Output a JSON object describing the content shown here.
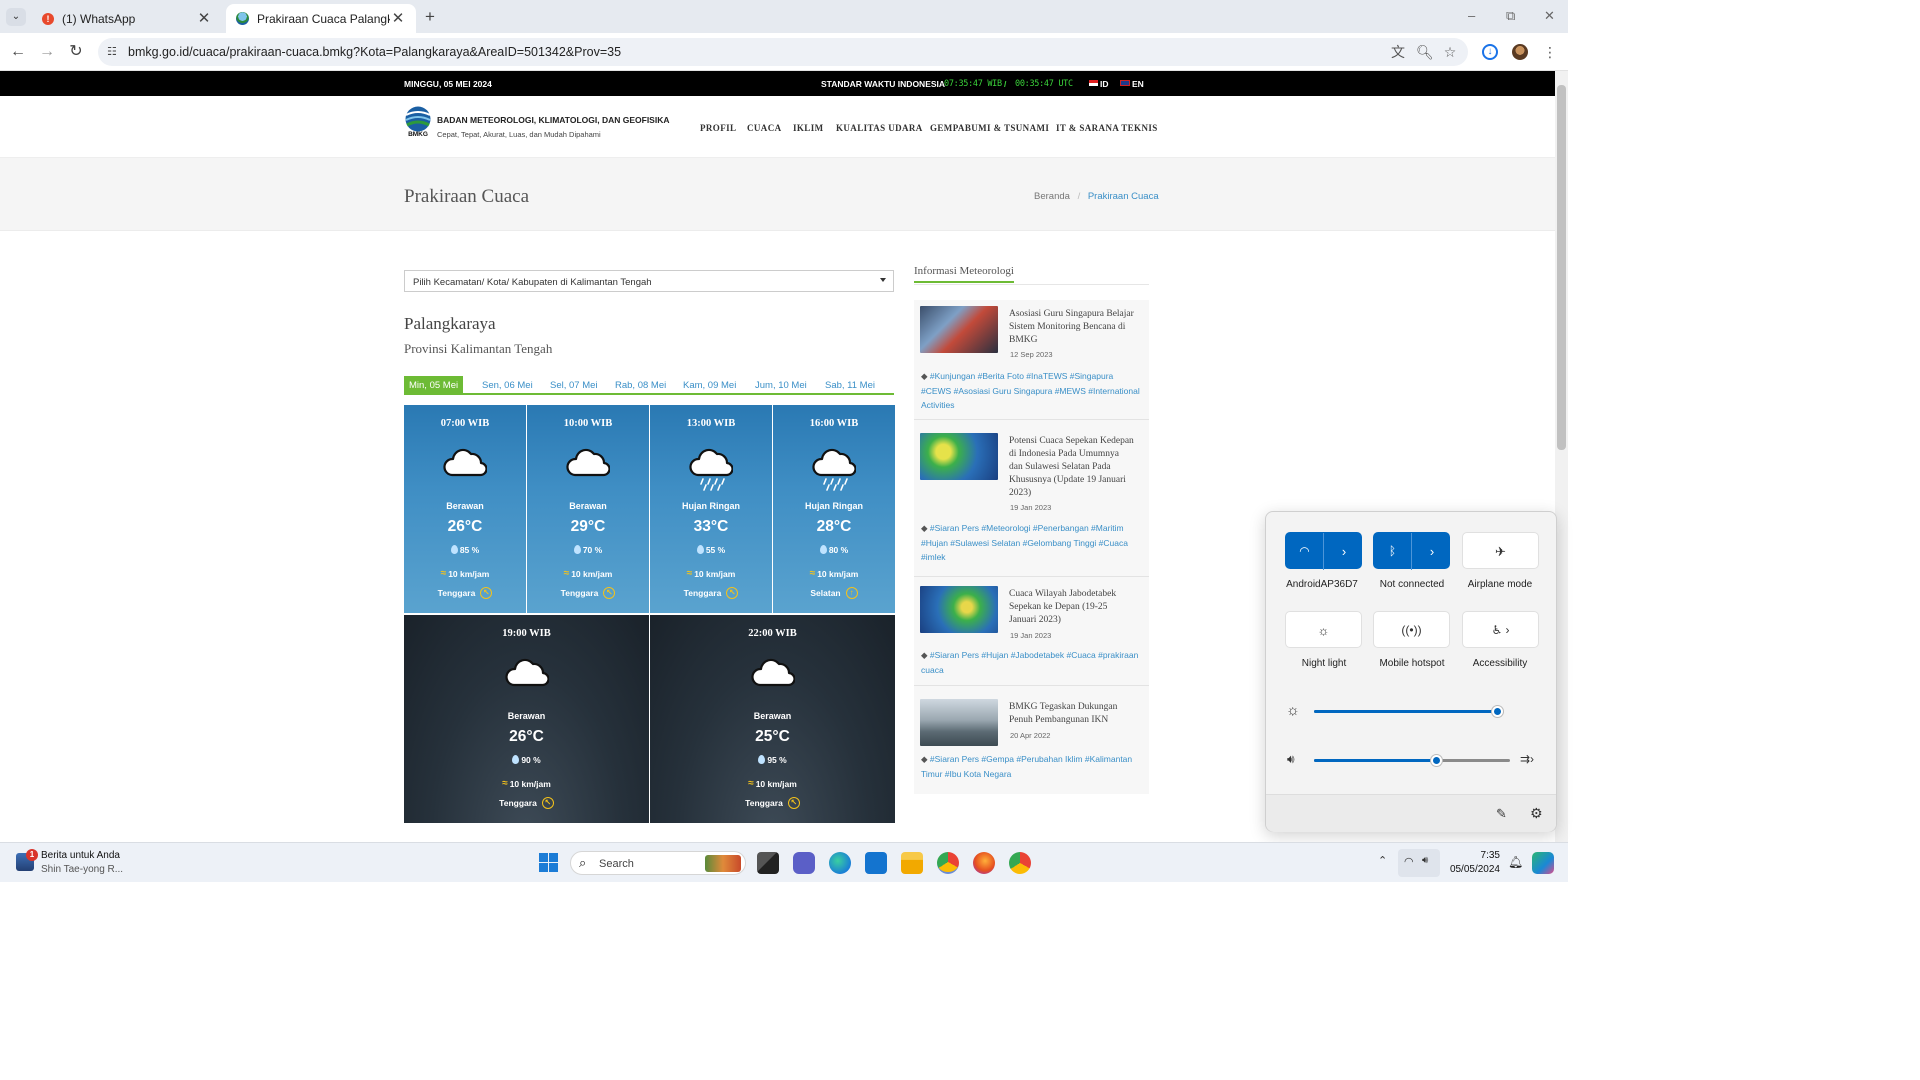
{
  "browser": {
    "tabs": [
      {
        "label": "(1) WhatsApp"
      },
      {
        "label": "Prakiraan Cuaca Palangkaraya -"
      }
    ],
    "url": "bmkg.go.id/cuaca/prakiraan-cuaca.bmkg?Kota=Palangkaraya&AreaID=501342&Prov=35"
  },
  "topbar": {
    "date": "MINGGU, 05 MEI 2024",
    "std_label": "STANDAR WAKTU INDONESIA",
    "wib": "07:35:47 WIB",
    "utc": "00:35:47 UTC",
    "lang_id": "ID",
    "lang_en": "EN",
    "clock_color": "#3ad23a"
  },
  "header": {
    "logo_text": "BMKG",
    "org": "BADAN METEOROLOGI, KLIMATOLOGI, DAN GEOFISIKA",
    "tagline": "Cepat, Tepat, Akurat, Luas, dan Mudah Dipahami",
    "menu": [
      "PROFIL",
      "CUACA",
      "IKLIM",
      "KUALITAS UDARA",
      "GEMPABUMI & TSUNAMI",
      "IT & SARANA TEKNIS"
    ]
  },
  "page": {
    "title": "Prakiraan Cuaca",
    "breadcrumb": {
      "home": "Beranda",
      "sep": "/",
      "current": "Prakiraan Cuaca"
    },
    "select": "Pilih Kecamatan/ Kota/ Kabupaten di Kalimantan Tengah",
    "city": "Palangkaraya",
    "province": "Provinsi Kalimantan Tengah",
    "accent": "#6dbb35",
    "link_color": "#3a8fc7"
  },
  "day_tabs": [
    "Min, 05 Mei",
    "Sen, 06 Mei",
    "Sel, 07 Mei",
    "Rab, 08 Mei",
    "Kam, 09 Mei",
    "Jum, 10 Mei",
    "Sab, 11 Mei"
  ],
  "forecast": [
    {
      "time": "07:00 WIB",
      "icon": "cloudy-icon",
      "cond": "Berawan",
      "temp": "26°C",
      "hum": "85 %",
      "wind": "10 km/jam",
      "dir": "Tenggara"
    },
    {
      "time": "10:00 WIB",
      "icon": "cloudy-icon",
      "cond": "Berawan",
      "temp": "29°C",
      "hum": "70 %",
      "wind": "10 km/jam",
      "dir": "Tenggara"
    },
    {
      "time": "13:00 WIB",
      "icon": "light-rain-icon",
      "cond": "Hujan Ringan",
      "temp": "33°C",
      "hum": "55 %",
      "wind": "10 km/jam",
      "dir": "Tenggara"
    },
    {
      "time": "16:00 WIB",
      "icon": "light-rain-icon",
      "cond": "Hujan Ringan",
      "temp": "28°C",
      "hum": "80 %",
      "wind": "10 km/jam",
      "dir": "Selatan"
    },
    {
      "time": "19:00 WIB",
      "icon": "cloudy-icon",
      "cond": "Berawan",
      "temp": "26°C",
      "hum": "90 %",
      "wind": "10 km/jam",
      "dir": "Tenggara"
    },
    {
      "time": "22:00 WIB",
      "icon": "cloudy-icon",
      "cond": "Berawan",
      "temp": "25°C",
      "hum": "95 %",
      "wind": "10 km/jam",
      "dir": "Tenggara"
    }
  ],
  "sidebar": {
    "title": "Informasi Meteorologi",
    "news": [
      {
        "title": "Asosiasi Guru Singapura Belajar Sistem Monitoring Bencana di BMKG",
        "date": "12 Sep 2023",
        "tags": "#Kunjungan #Berita Foto #InaTEWS #Singapura #CEWS #Asosiasi Guru Singapura #MEWS #International Activities"
      },
      {
        "title": "Potensi Cuaca Sepekan Kedepan di Indonesia Pada Umumnya dan Sulawesi Selatan Pada Khususnya (Update 19 Januari 2023)",
        "date": "19 Jan 2023",
        "tags": "#Siaran Pers #Meteorologi #Penerbangan #Maritim #Hujan #Sulawesi Selatan #Gelombang Tinggi #Cuaca #imlek"
      },
      {
        "title": "Cuaca Wilayah Jabodetabek Sepekan ke Depan (19-25 Januari 2023)",
        "date": "19 Jan 2023",
        "tags": "#Siaran Pers #Hujan #Jabodetabek #Cuaca #prakiraan cuaca"
      },
      {
        "title": "BMKG Tegaskan Dukungan Penuh Pembangunan IKN",
        "date": "20 Apr 2022",
        "tags": "#Siaran Pers #Gempa #Perubahan Iklim #Kalimantan Timur #Ibu Kota Negara"
      }
    ]
  },
  "quick_settings": {
    "wifi": "AndroidAP36D7",
    "bluetooth": "Not connected",
    "airplane": "Airplane mode",
    "night_light": "Night light",
    "hotspot": "Mobile hotspot",
    "accessibility": "Accessibility",
    "brightness": 0.97,
    "volume": 0.63,
    "accent": "#0067c0"
  },
  "taskbar": {
    "news_title": "Berita untuk Anda",
    "news_sub": "Shin Tae-yong R...",
    "news_badge": "1",
    "search": "Search",
    "time": "7:35",
    "date": "05/05/2024"
  }
}
